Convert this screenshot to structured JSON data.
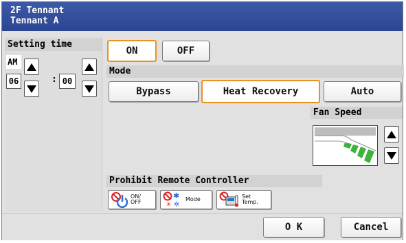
{
  "title": {
    "line1": "2F Tennant",
    "line2": "Tennant A"
  },
  "setting_time": {
    "label": "Setting time",
    "ampm": "AM",
    "hour": "06",
    "separator": ":",
    "minute": "00"
  },
  "power": {
    "on_label": "ON",
    "off_label": "OFF",
    "selected": "ON"
  },
  "mode": {
    "label": "Mode",
    "options": [
      "Bypass",
      "Heat Recovery",
      "Auto"
    ],
    "selected": "Heat Recovery"
  },
  "fan_speed": {
    "label": "Fan Speed",
    "level": 3
  },
  "prohibit": {
    "label": "Prohibit Remote Controller",
    "on_off": "ON/\nOFF",
    "mode": "Mode",
    "set_temp": "Set\nTemp."
  },
  "footer": {
    "ok_label": "O K",
    "cancel_label": "Cancel"
  },
  "colors": {
    "title_bg": "#2f4a96",
    "selection": "#e8931f",
    "fan_green": "#3db33d",
    "prohibit_red": "#e02020",
    "icon_blue": "#2a6fd0"
  }
}
